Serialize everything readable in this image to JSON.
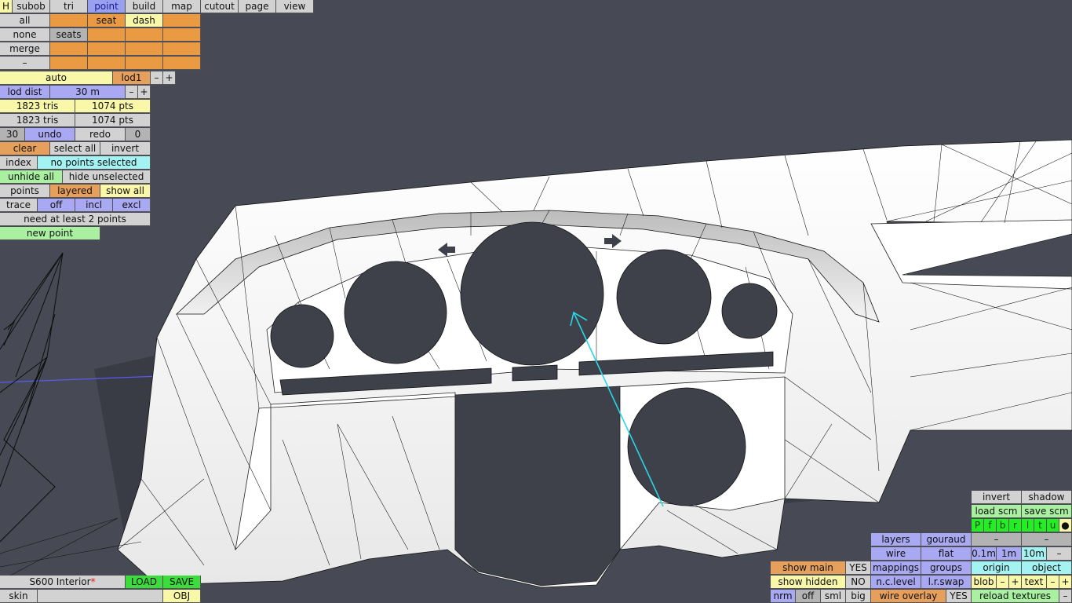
{
  "toolbar": {
    "modes": [
      "subob",
      "tri",
      "point",
      "build",
      "map",
      "cutout",
      "page",
      "view"
    ],
    "h_label": "H",
    "active_mode": "point"
  },
  "subobject_panel": {
    "all": "all",
    "none": "none",
    "merge": "merge",
    "dash_small": "–",
    "seat": "seat",
    "dash": "dash",
    "seats": "seats"
  },
  "lod": {
    "auto": "auto",
    "level": "lod1",
    "minus": "–",
    "plus": "+",
    "dist_label": "lod dist",
    "dist_value": "30 m"
  },
  "stats": {
    "tris_total": "1823 tris",
    "pts_total": "1074 pts",
    "tris_visible": "1823 tris",
    "pts_visible": "1074 pts"
  },
  "history": {
    "undo_count": "30",
    "undo": "undo",
    "redo": "redo",
    "redo_count": "0"
  },
  "selection": {
    "clear": "clear",
    "select_all": "select all",
    "invert": "invert",
    "index": "index",
    "status": "no points selected",
    "unhide_all": "unhide all",
    "hide_unselected": "hide unselected",
    "points": "points",
    "layered": "layered",
    "show_all": "show all",
    "trace": "trace",
    "off": "off",
    "incl": "incl",
    "excl": "excl",
    "hint": "need at least 2 points",
    "new_point": "new point"
  },
  "bottom_left": {
    "filename": "S600 Interior",
    "modified_mark": "*",
    "load": "LOAD",
    "save": "SAVE",
    "skin": "skin",
    "obj": "OBJ"
  },
  "bottom_right": {
    "show_main": "show main",
    "show_main_value": "YES",
    "show_hidden": "show hidden",
    "show_hidden_value": "NO",
    "nrm": "nrm",
    "off": "off",
    "sml": "sml",
    "big": "big",
    "layers": "layers",
    "gouraud": "gouraud",
    "wire": "wire",
    "flat": "flat",
    "mappings": "mappings",
    "groups": "groups",
    "nc_level": "n.c.level",
    "lr_swap": "l.r.swap",
    "wire_overlay": "wire overlay",
    "wire_overlay_value": "YES",
    "invert": "invert",
    "shadow": "shadow",
    "load_scm": "load scm",
    "save_scm": "save scm",
    "view_letters": [
      "P",
      "f",
      "b",
      "r",
      "l",
      "t",
      "u",
      "●"
    ],
    "dash": "–",
    "step_01": "0.1m",
    "step_1": "1m",
    "step_10": "10m",
    "minus": "–",
    "plus": "+",
    "origin": "origin",
    "object": "object",
    "blob": "blob",
    "text": "text",
    "reload_textures": "reload textures"
  },
  "colors": {
    "background": "#474a54",
    "mesh": "#ffffff",
    "wire": "#111111",
    "axis": "#5a5af0",
    "gizmo": "#29d6e6"
  }
}
